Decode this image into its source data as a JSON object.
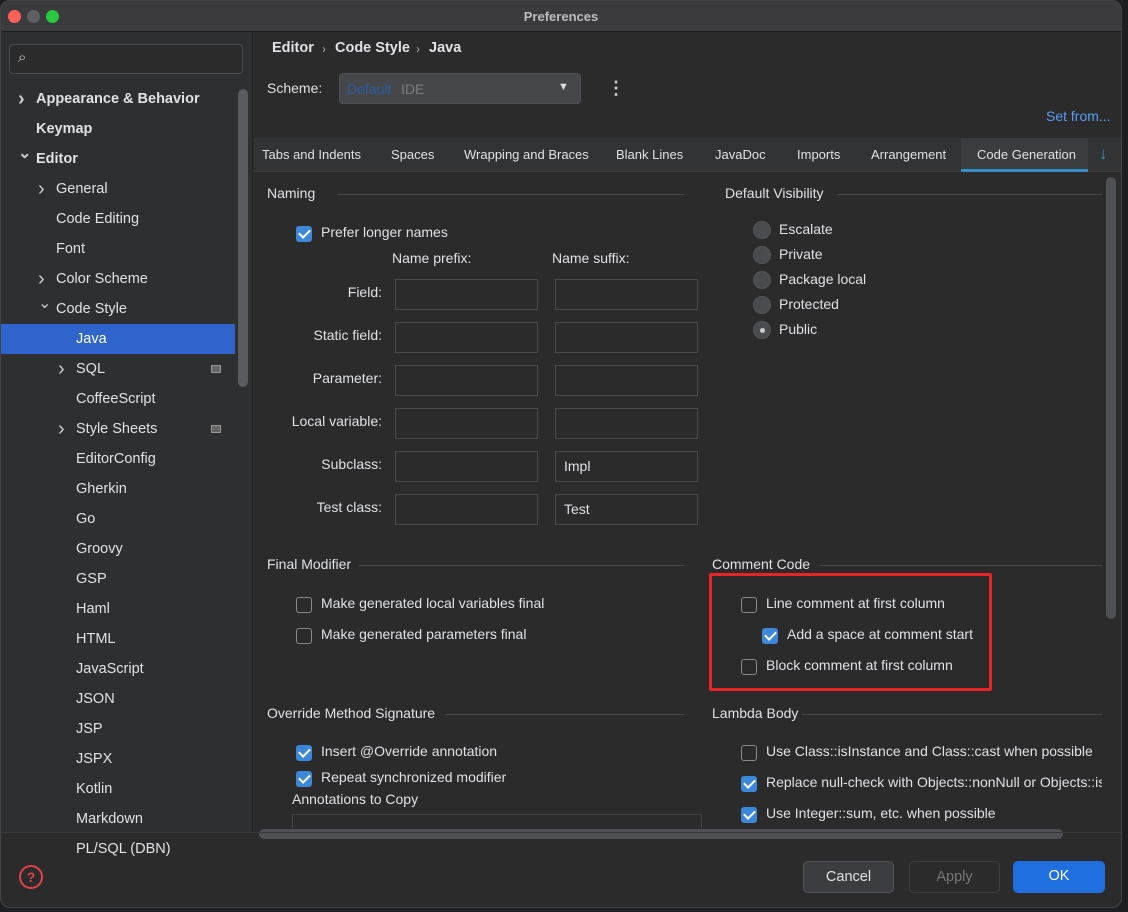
{
  "window": {
    "title": "Preferences"
  },
  "sidebar": {
    "items": [
      {
        "label": "Appearance & Behavior",
        "level": 0,
        "chevron": "right",
        "bold": true
      },
      {
        "label": "Keymap",
        "level": 0,
        "bold": true
      },
      {
        "label": "Editor",
        "level": 0,
        "chevron": "down",
        "bold": true
      },
      {
        "label": "General",
        "level": 1,
        "chevron": "right"
      },
      {
        "label": "Code Editing",
        "level": 1
      },
      {
        "label": "Font",
        "level": 1
      },
      {
        "label": "Color Scheme",
        "level": 1,
        "chevron": "right"
      },
      {
        "label": "Code Style",
        "level": 1,
        "chevron": "down"
      },
      {
        "label": "Java",
        "level": 2,
        "selected": true
      },
      {
        "label": "SQL",
        "level": 2,
        "chevron": "right",
        "badge": true
      },
      {
        "label": "CoffeeScript",
        "level": 2
      },
      {
        "label": "Style Sheets",
        "level": 2,
        "chevron": "right",
        "badge": true
      },
      {
        "label": "EditorConfig",
        "level": 2
      },
      {
        "label": "Gherkin",
        "level": 2
      },
      {
        "label": "Go",
        "level": 2
      },
      {
        "label": "Groovy",
        "level": 2
      },
      {
        "label": "GSP",
        "level": 2
      },
      {
        "label": "Haml",
        "level": 2
      },
      {
        "label": "HTML",
        "level": 2
      },
      {
        "label": "JavaScript",
        "level": 2
      },
      {
        "label": "JSON",
        "level": 2
      },
      {
        "label": "JSP",
        "level": 2
      },
      {
        "label": "JSPX",
        "level": 2
      },
      {
        "label": "Kotlin",
        "level": 2
      },
      {
        "label": "Markdown",
        "level": 2
      },
      {
        "label": "PL/SQL (DBN)",
        "level": 2
      }
    ]
  },
  "breadcrumb": [
    "Editor",
    "Code Style",
    "Java"
  ],
  "scheme": {
    "label": "Scheme:",
    "value_main": "Default",
    "value_sub": "IDE",
    "set_from": "Set from..."
  },
  "tabs": [
    "Tabs and Indents",
    "Spaces",
    "Wrapping and Braces",
    "Blank Lines",
    "JavaDoc",
    "Imports",
    "Arrangement",
    "Code Generation"
  ],
  "selected_tab": "Code Generation",
  "naming": {
    "title": "Naming",
    "prefer_longer": {
      "label": "Prefer longer names",
      "checked": true
    },
    "prefix_header": "Name prefix:",
    "suffix_header": "Name suffix:",
    "rows": [
      {
        "label": "Field:",
        "prefix": "",
        "suffix": ""
      },
      {
        "label": "Static field:",
        "prefix": "",
        "suffix": ""
      },
      {
        "label": "Parameter:",
        "prefix": "",
        "suffix": ""
      },
      {
        "label": "Local variable:",
        "prefix": "",
        "suffix": ""
      },
      {
        "label": "Subclass:",
        "prefix": "",
        "suffix": "Impl"
      },
      {
        "label": "Test class:",
        "prefix": "",
        "suffix": "Test"
      }
    ]
  },
  "visibility": {
    "title": "Default Visibility",
    "options": [
      "Escalate",
      "Private",
      "Package local",
      "Protected",
      "Public"
    ],
    "selected": "Public"
  },
  "final_modifier": {
    "title": "Final Modifier",
    "items": [
      {
        "label": "Make generated local variables final",
        "checked": false
      },
      {
        "label": "Make generated parameters final",
        "checked": false
      }
    ]
  },
  "comment_code": {
    "title": "Comment Code",
    "items": [
      {
        "label": "Line comment at first column",
        "checked": false
      },
      {
        "label": "Add a space at comment start",
        "checked": true
      },
      {
        "label": "Block comment at first column",
        "checked": false
      }
    ]
  },
  "override": {
    "title": "Override Method Signature",
    "items": [
      {
        "label": "Insert @Override annotation",
        "checked": true
      },
      {
        "label": "Repeat synchronized modifier",
        "checked": true
      }
    ],
    "annotations_label": "Annotations to Copy"
  },
  "lambda": {
    "title": "Lambda Body",
    "items": [
      {
        "label": "Use Class::isInstance and Class::cast when possible",
        "checked": false
      },
      {
        "label": "Replace null-check with Objects::nonNull or Objects::isNull",
        "checked": true
      },
      {
        "label": "Use Integer::sum, etc. when possible",
        "checked": true
      }
    ]
  },
  "buttons": {
    "cancel": "Cancel",
    "apply": "Apply",
    "ok": "OK"
  },
  "colors": {
    "accent": "#2f65ca",
    "ok": "#1f6fe0",
    "highlight": "#e8232a"
  }
}
